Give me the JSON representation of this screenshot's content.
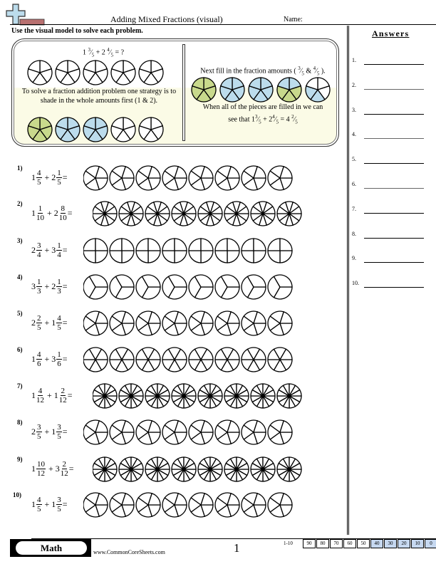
{
  "header": {
    "title": "Adding Mixed Fractions (visual)",
    "name_label": "Name:",
    "instructions": "Use the visual model to solve each problem."
  },
  "example": {
    "left_expr": {
      "w1": "1",
      "n1": "3",
      "d1": "5",
      "w2": "2",
      "n2": "4",
      "d2": "5",
      "tail": "= ?"
    },
    "left_text": "To solve a fraction addition problem one strategy is to shade in the whole amounts first (1 & 2).",
    "right_text_1": "Next fill in the fraction amounts (",
    "right_text_1_fracs": {
      "n1": "3",
      "d1": "5",
      "n2": "4",
      "d2": "5"
    },
    "right_text_2": "When all of the pieces are filled in we can",
    "right_text_3_prefix": "see that ",
    "right_result": {
      "w1": "1",
      "n1": "3",
      "d1": "5",
      "w2": "2",
      "n2": "4",
      "d2": "5",
      "w3": "4",
      "n3": "2",
      "d3": "5"
    },
    "colors": {
      "green": "#c8d98c",
      "blue": "#bcdcec",
      "white": "#ffffff"
    },
    "left_top_circles": [
      [
        0,
        0,
        0,
        0,
        0
      ],
      [
        0,
        0,
        0,
        0,
        0
      ],
      [
        0,
        0,
        0,
        0,
        0
      ],
      [
        0,
        0,
        0,
        0,
        0
      ],
      [
        0,
        0,
        0,
        0,
        0
      ]
    ],
    "left_bottom_circles": [
      [
        "g",
        "g",
        "g",
        "g",
        "g"
      ],
      [
        "b",
        "b",
        "b",
        "b",
        "b"
      ],
      [
        "b",
        "b",
        "b",
        "b",
        "b"
      ],
      [
        0,
        0,
        0,
        0,
        0
      ],
      [
        0,
        0,
        0,
        0,
        0
      ]
    ],
    "right_circles": [
      [
        "g",
        "g",
        "g",
        "g",
        "g"
      ],
      [
        "b",
        "b",
        "b",
        "b",
        "b"
      ],
      [
        "b",
        "b",
        "b",
        "b",
        "b"
      ],
      [
        "b",
        "g",
        "g",
        "g",
        "b"
      ],
      [
        0,
        0,
        "b",
        "b",
        0
      ]
    ]
  },
  "problems": [
    {
      "num": "1)",
      "w1": "1",
      "n1": "4",
      "d1": "5",
      "w2": "2",
      "n2": "1",
      "d2": "5",
      "parts": 5,
      "circles": 8
    },
    {
      "num": "2)",
      "w1": "1",
      "n1": "1",
      "d1": "10",
      "w2": "2",
      "n2": "8",
      "d2": "10",
      "parts": 10,
      "circles": 8
    },
    {
      "num": "3)",
      "w1": "2",
      "n1": "3",
      "d1": "4",
      "w2": "3",
      "n2": "1",
      "d2": "4",
      "parts": 4,
      "circles": 8
    },
    {
      "num": "4)",
      "w1": "3",
      "n1": "1",
      "d1": "3",
      "w2": "2",
      "n2": "1",
      "d2": "3",
      "parts": 3,
      "circles": 8
    },
    {
      "num": "5)",
      "w1": "2",
      "n1": "2",
      "d1": "5",
      "w2": "1",
      "n2": "4",
      "d2": "5",
      "parts": 5,
      "circles": 8
    },
    {
      "num": "6)",
      "w1": "1",
      "n1": "4",
      "d1": "6",
      "w2": "3",
      "n2": "1",
      "d2": "6",
      "parts": 6,
      "circles": 8
    },
    {
      "num": "7)",
      "w1": "1",
      "n1": "4",
      "d1": "12",
      "w2": "1",
      "n2": "2",
      "d2": "12",
      "parts": 12,
      "circles": 8
    },
    {
      "num": "8)",
      "w1": "2",
      "n1": "3",
      "d1": "5",
      "w2": "1",
      "n2": "3",
      "d2": "5",
      "parts": 5,
      "circles": 8
    },
    {
      "num": "9)",
      "w1": "1",
      "n1": "10",
      "d1": "12",
      "w2": "3",
      "n2": "2",
      "d2": "12",
      "parts": 12,
      "circles": 8
    },
    {
      "num": "10)",
      "w1": "1",
      "n1": "4",
      "d1": "5",
      "w2": "1",
      "n2": "3",
      "d2": "5",
      "parts": 5,
      "circles": 8
    }
  ],
  "answers": {
    "title": "Answers",
    "labels": [
      "1.",
      "2.",
      "3.",
      "4.",
      "5.",
      "6.",
      "7.",
      "8.",
      "9.",
      "10."
    ]
  },
  "footer": {
    "subject": "Math",
    "site": "www.CommonCoreSheets.com",
    "page": "1",
    "score_label": "1-10",
    "scores": [
      "90",
      "80",
      "70",
      "60",
      "50",
      "40",
      "30",
      "20",
      "10",
      "0"
    ],
    "score_highlight_from": 5,
    "score_highlight_color": "#c6d8f0"
  }
}
